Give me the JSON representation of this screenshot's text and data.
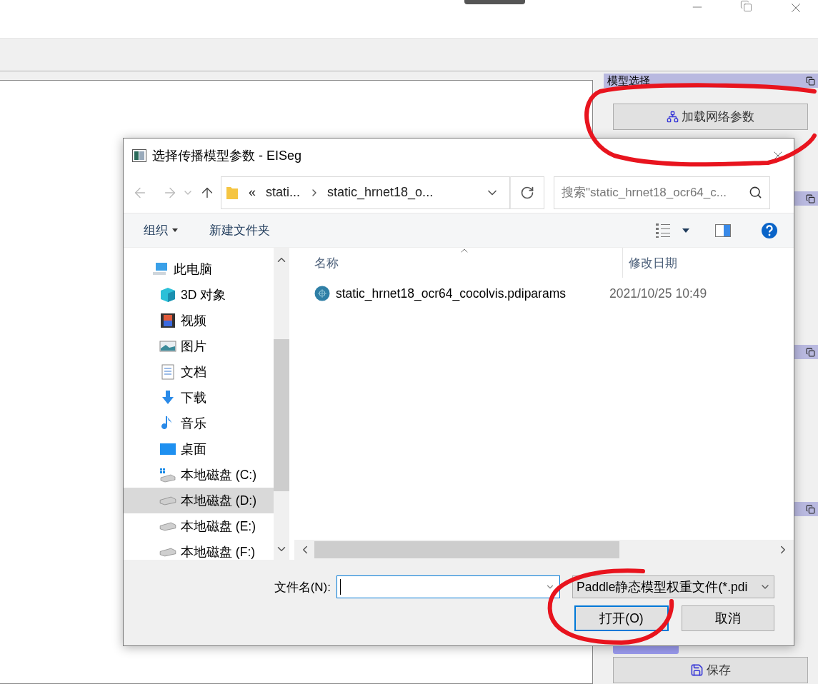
{
  "app": {
    "panel_title": "模型选择",
    "load_button": "加载网络参数",
    "save_button": "保存"
  },
  "dialog": {
    "title": "选择传播模型参数 - EISeg",
    "address": {
      "overflow": "«",
      "segments": [
        "stati...",
        "static_hrnet18_o..."
      ]
    },
    "search": {
      "placeholder": "搜索\"static_hrnet18_ocr64_c..."
    },
    "commands": [
      {
        "label": "组织",
        "dropdown": true
      },
      {
        "label": "新建文件夹",
        "dropdown": false
      }
    ],
    "tree": [
      {
        "label": "此电脑",
        "kind": "computer",
        "selected": false,
        "children": [
          {
            "label": "3D 对象",
            "kind": "cube",
            "selected": false
          },
          {
            "label": "视频",
            "kind": "video",
            "selected": false
          },
          {
            "label": "图片",
            "kind": "image",
            "selected": false
          },
          {
            "label": "文档",
            "kind": "document",
            "selected": false
          },
          {
            "label": "下载",
            "kind": "download",
            "selected": false
          },
          {
            "label": "音乐",
            "kind": "music",
            "selected": false
          },
          {
            "label": "桌面",
            "kind": "desktop",
            "selected": false
          },
          {
            "label": "本地磁盘 (C:)",
            "kind": "system-drive",
            "selected": false
          },
          {
            "label": "本地磁盘 (D:)",
            "kind": "drive",
            "selected": true
          },
          {
            "label": "本地磁盘 (E:)",
            "kind": "drive",
            "selected": false
          },
          {
            "label": "本地磁盘 (F:)",
            "kind": "drive",
            "selected": false
          }
        ]
      }
    ],
    "columns": [
      "名称",
      "修改日期"
    ],
    "files": [
      {
        "name": "static_hrnet18_ocr64_cocolvis.pdiparams",
        "modified": "2021/10/25 10:49"
      }
    ],
    "filename_label": "文件名(N):",
    "filter": "Paddle静态模型权重文件(*.pdi",
    "buttons": [
      {
        "label": "打开(O)",
        "default": true
      },
      {
        "label": "取消",
        "default": false
      }
    ]
  }
}
